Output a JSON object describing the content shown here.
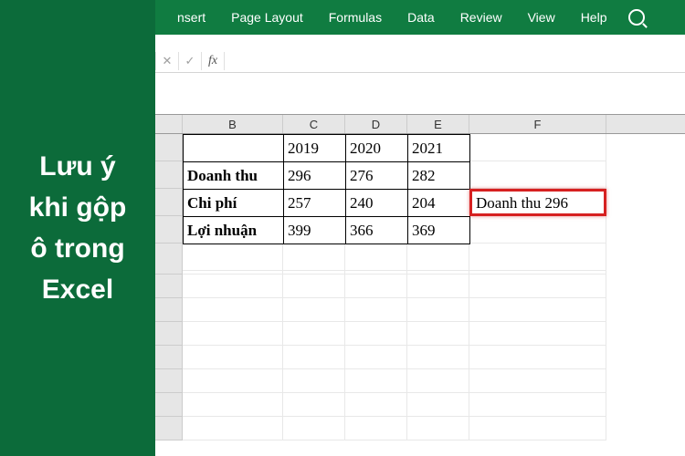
{
  "sidebar": {
    "message": "Lưu ý khi gộp ô trong Excel"
  },
  "ribbon": {
    "tabs": [
      "nsert",
      "Page Layout",
      "Formulas",
      "Data",
      "Review",
      "View",
      "Help"
    ]
  },
  "formulaBar": {
    "cancel": "✕",
    "confirm": "✓",
    "fx": "fx",
    "value": ""
  },
  "columns": {
    "B": "B",
    "C": "C",
    "D": "D",
    "E": "E",
    "F": "F"
  },
  "table": {
    "header": {
      "blank": "",
      "y1": "2019",
      "y2": "2020",
      "y3": "2021"
    },
    "rows": [
      {
        "label": "Doanh thu",
        "v1": "296",
        "v2": "276",
        "v3": "282"
      },
      {
        "label": "Chi phí",
        "v1": "257",
        "v2": "240",
        "v3": "204"
      },
      {
        "label": "Lợi nhuận",
        "v1": "399",
        "v2": "366",
        "v3": "369"
      }
    ]
  },
  "highlight": {
    "text": "Doanh thu 296"
  }
}
